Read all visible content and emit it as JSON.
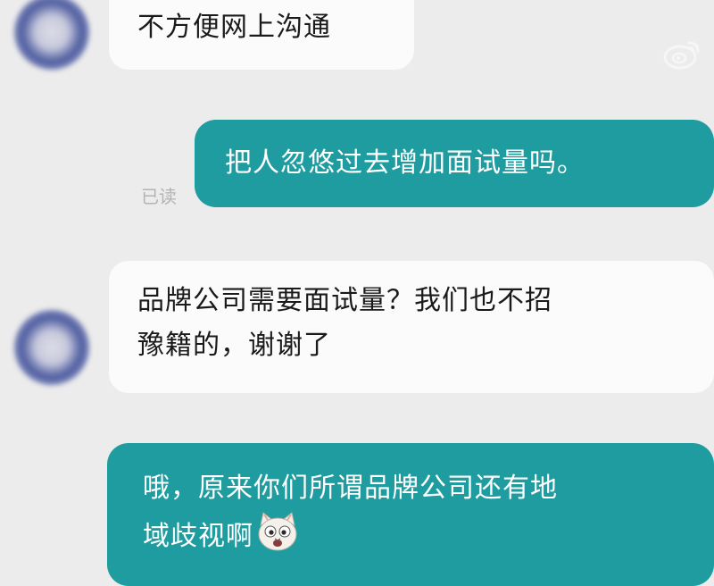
{
  "conversation": {
    "messages": [
      {
        "side": "incoming",
        "lines": [
          "不方便网上沟通"
        ]
      },
      {
        "side": "outgoing",
        "lines": [
          "把人忽悠过去增加面试量吗。"
        ],
        "status": "已读"
      },
      {
        "side": "incoming",
        "lines": [
          "品牌公司需要面试量？我们也不招",
          "豫籍的，谢谢了"
        ]
      },
      {
        "side": "outgoing",
        "lines": [
          "哦，原来你们所谓品牌公司还有地",
          "域歧视啊"
        ],
        "emoji": "cat-face"
      }
    ]
  },
  "colors": {
    "background": "#ececec",
    "incoming_bubble": "#fbfbfb",
    "outgoing_bubble": "#1e9c9f",
    "read_receipt": "#b3b3b3"
  },
  "icons": [
    "avatar",
    "cat-emoji",
    "weibo-watermark-icon"
  ]
}
